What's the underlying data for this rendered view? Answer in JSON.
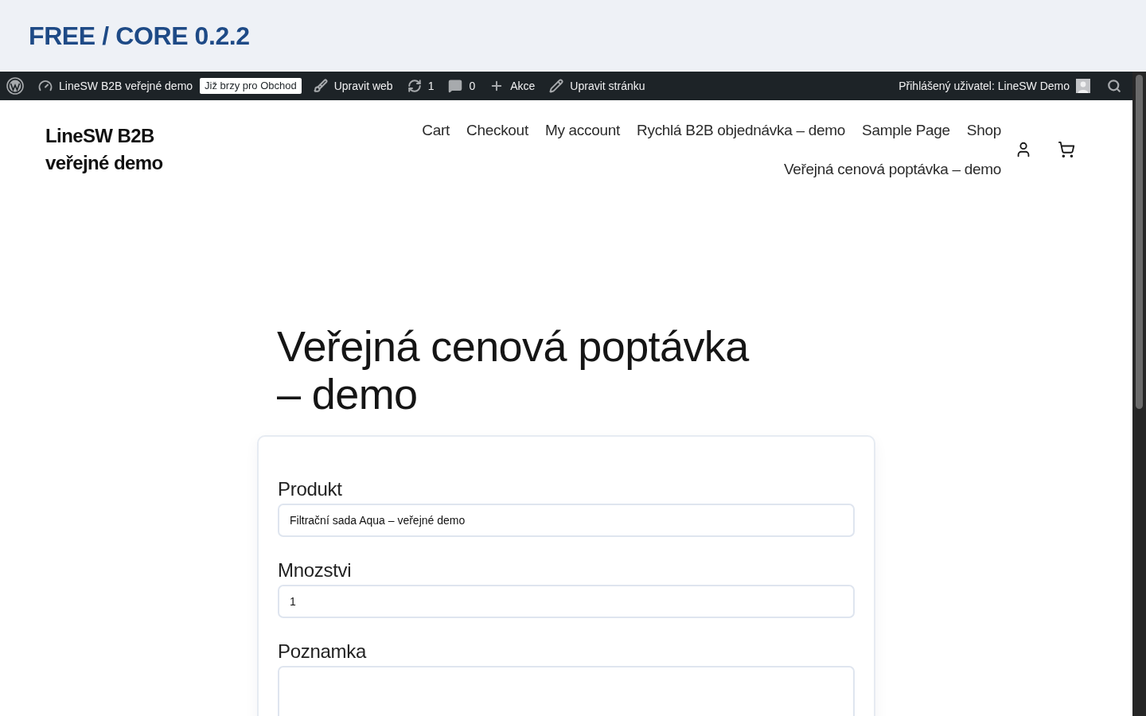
{
  "banner": {
    "title": "FREE / CORE 0.2.2"
  },
  "admin_bar": {
    "site_name": "LineSW B2B veřejné demo",
    "badge": "Již brzy pro Obchod",
    "items": [
      {
        "kind": "customize",
        "label": "Upravit web"
      },
      {
        "kind": "updates",
        "label": "1"
      },
      {
        "kind": "comments",
        "label": "0"
      },
      {
        "kind": "new",
        "label": "Akce"
      },
      {
        "kind": "edit",
        "label": "Upravit stránku"
      }
    ],
    "account": "Přihlášený uživatel: LineSW Demo"
  },
  "site_header": {
    "site_title": "LineSW B2B veřejné demo",
    "nav": [
      "Cart",
      "Checkout",
      "My account",
      "Rychlá B2B objednávka – demo",
      "Sample Page",
      "Shop",
      "Veřejná cenová poptávka – demo"
    ]
  },
  "page": {
    "title": "Veřejná cenová poptávka – demo",
    "fields": [
      {
        "kind": "text",
        "label": "Produkt",
        "value": "Filtrační sada Aqua – veřejné demo"
      },
      {
        "kind": "text",
        "label": "Mnozstvi",
        "value": "1"
      },
      {
        "kind": "textarea",
        "label": "Poznamka"
      }
    ]
  }
}
